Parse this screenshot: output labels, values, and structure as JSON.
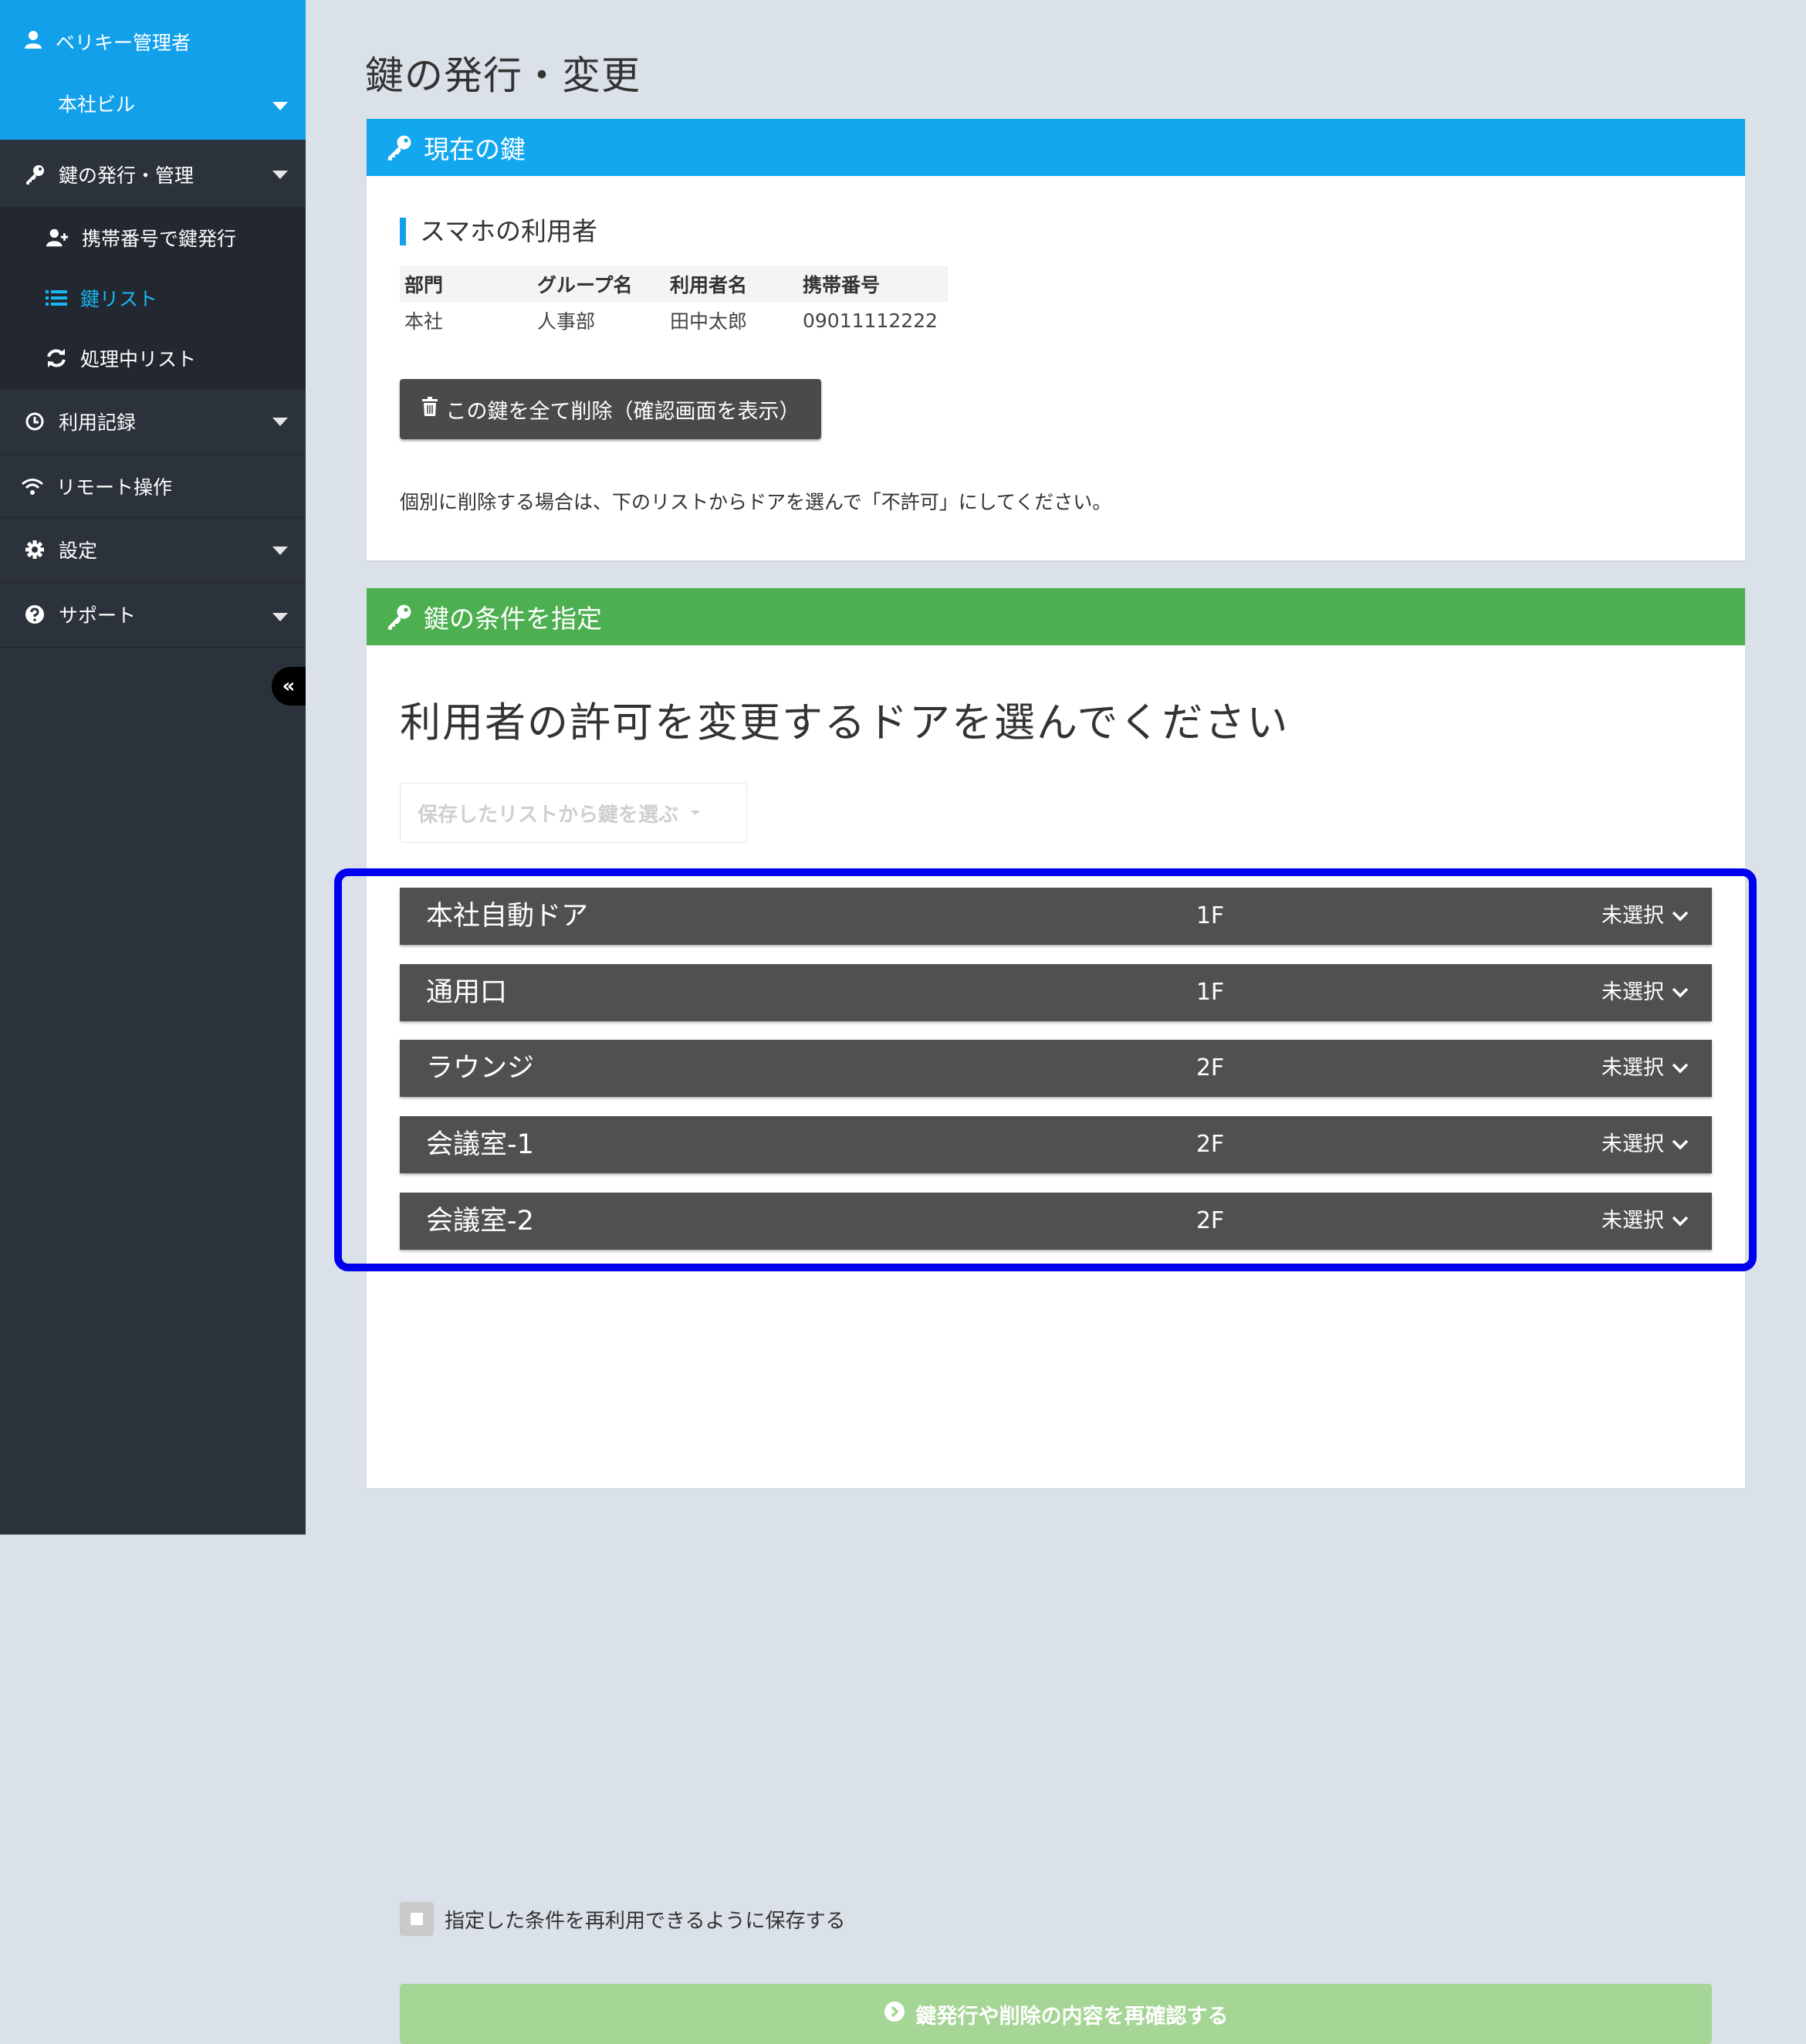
{
  "sidebar": {
    "user_name": "ベリキー管理者",
    "building": "本社ビル",
    "menu": {
      "key_manage": "鍵の発行・管理",
      "issue_by_phone": "携帯番号で鍵発行",
      "key_list": "鍵リスト",
      "processing_list": "処理中リスト",
      "usage_log": "利用記録",
      "remote": "リモート操作",
      "settings": "設定",
      "support": "サポート"
    },
    "collapse_label": "«",
    "colors": {
      "top": "#12a0eb",
      "active": "#19b6f2",
      "bg": "#2c323b"
    }
  },
  "page": {
    "title": "鍵の発行・変更"
  },
  "current_key": {
    "header": "現在の鍵",
    "subheading": "スマホの利用者",
    "columns": [
      "部門",
      "グループ名",
      "利用者名",
      "携帯番号"
    ],
    "row": [
      "本社",
      "人事部",
      "田中太郎",
      "09011112222"
    ],
    "delete_button": "この鍵を全て削除（確認画面を表示）",
    "note": "個別に削除する場合は、下のリストからドアを選んで「不許可」にしてください。"
  },
  "conditions": {
    "header": "鍵の条件を指定",
    "question": "利用者の許可を変更するドアを選んでください",
    "saved_list_placeholder": "保存したリストから鍵を選ぶ",
    "doors": [
      {
        "name": "本社自動ドア",
        "floor": "1F",
        "status": "未選択"
      },
      {
        "name": "通用口",
        "floor": "1F",
        "status": "未選択"
      },
      {
        "name": "ラウンジ",
        "floor": "2F",
        "status": "未選択"
      },
      {
        "name": "会議室-1",
        "floor": "2F",
        "status": "未選択"
      },
      {
        "name": "会議室-2",
        "floor": "2F",
        "status": "未選択"
      }
    ],
    "save_checkbox_label": "指定した条件を再利用できるように保存する",
    "confirm_button": "鍵発行や削除の内容を再確認する"
  }
}
